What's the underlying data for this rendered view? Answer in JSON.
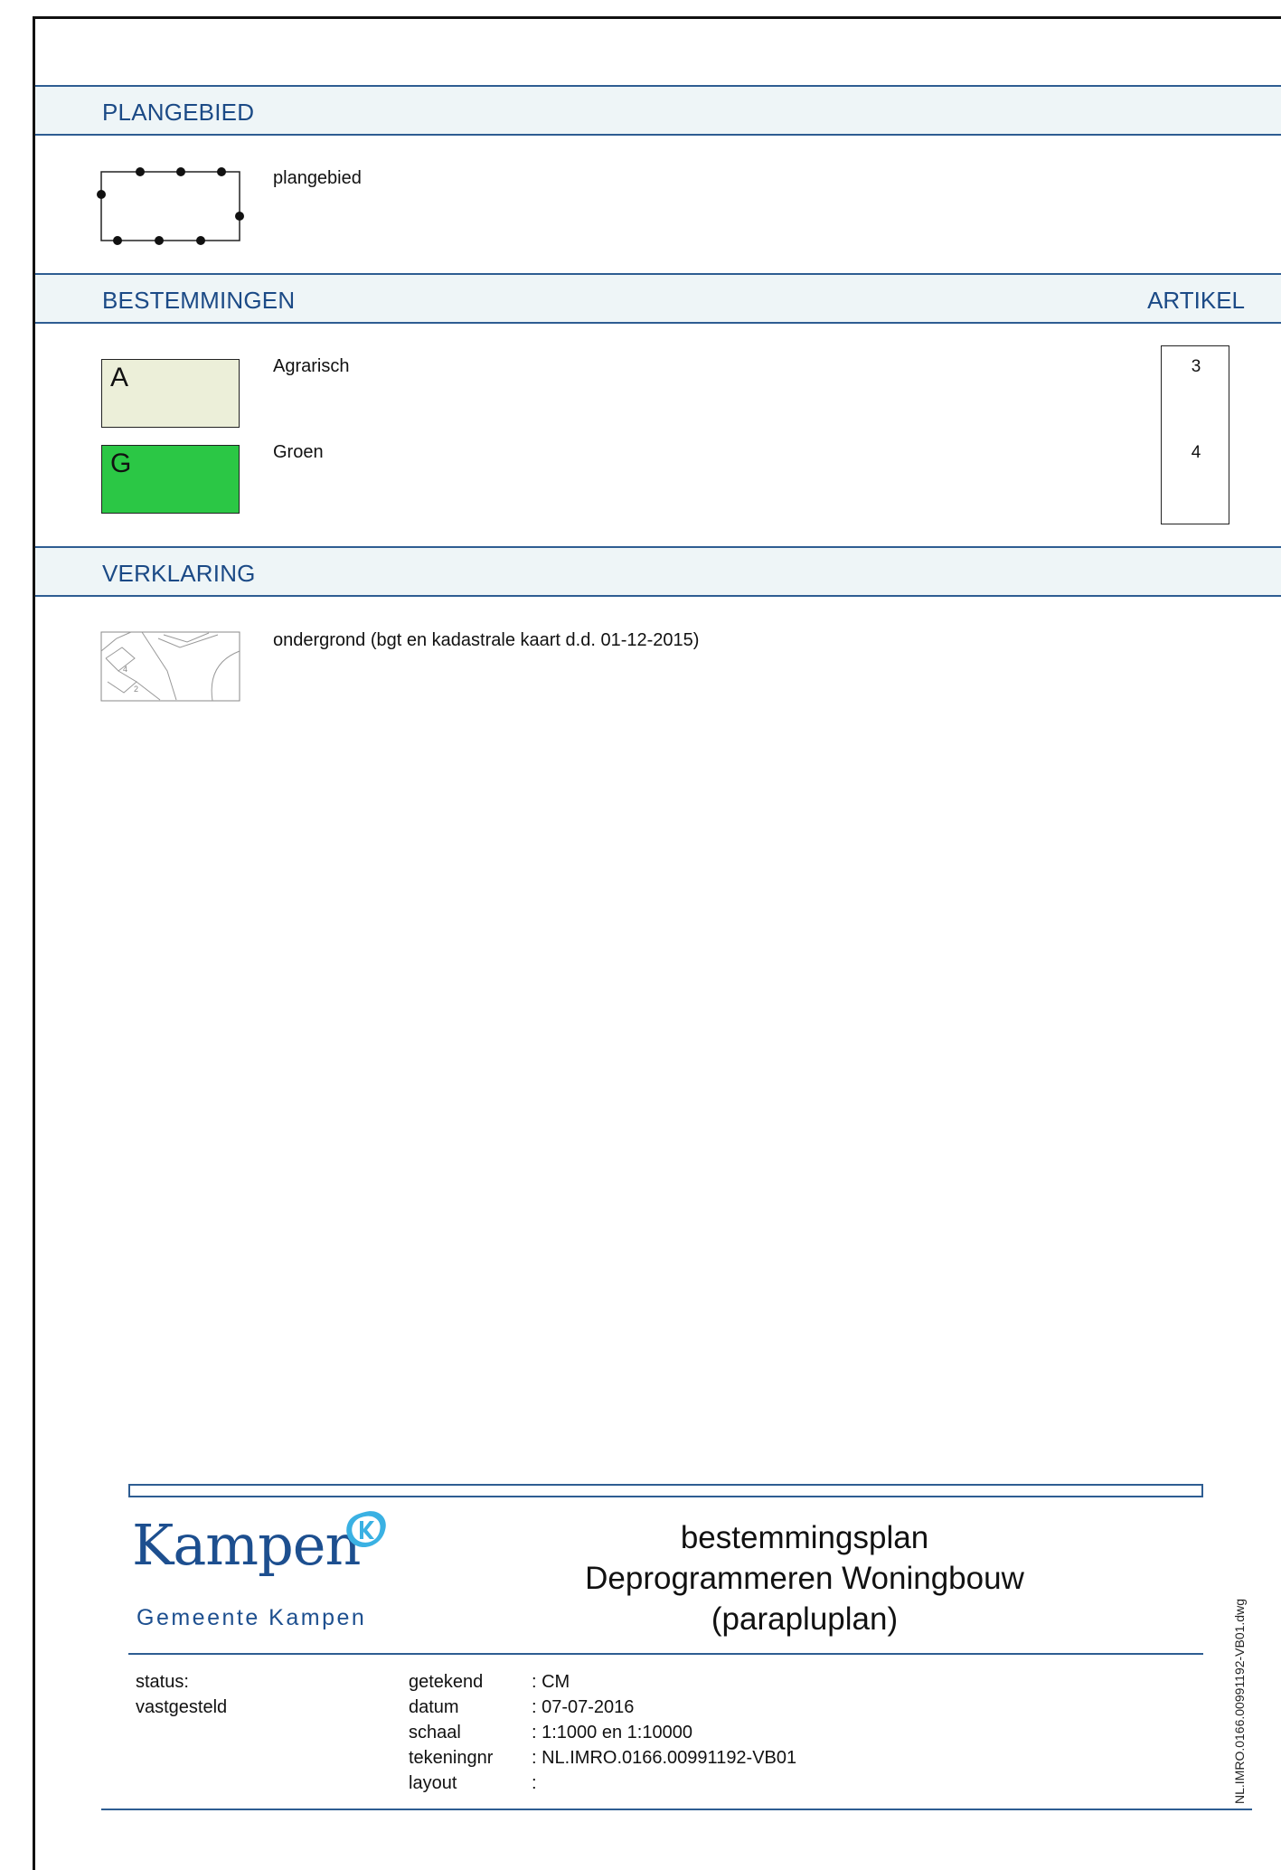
{
  "sections": {
    "plangebied": {
      "title": "PLANGEBIED",
      "item_label": "plangebied"
    },
    "bestemmingen": {
      "title": "BESTEMMINGEN",
      "artikel_header": "ARTIKEL",
      "items": [
        {
          "code": "A",
          "label": "Agrarisch",
          "artikel": "3",
          "color": "#ecefd9"
        },
        {
          "code": "G",
          "label": "Groen",
          "artikel": "4",
          "color": "#2bc745"
        }
      ]
    },
    "verklaring": {
      "title": "VERKLARING",
      "item_label": "ondergrond (bgt en kadastrale kaart d.d. 01-12-2015)",
      "map_numbers": [
        "4",
        "2"
      ]
    }
  },
  "titleblock": {
    "logo_text": "Kampen",
    "logo_subtitle": "Gemeente Kampen",
    "plan_title": [
      "bestemmingsplan",
      "Deprogrammeren Woningbouw",
      "(parapluplan)"
    ],
    "status_label": "status:",
    "status_value": "vastgesteld",
    "fields": [
      {
        "label": "getekend",
        "value": ": CM"
      },
      {
        "label": "datum",
        "value": ": 07-07-2016"
      },
      {
        "label": "schaal",
        "value": ": 1:1000 en 1:10000"
      },
      {
        "label": "tekeningnr",
        "value": ": NL.IMRO.0166.00991192-VB01"
      },
      {
        "label": "layout",
        "value": ":"
      }
    ],
    "filename": "NL.IMRO.0166.00991192-VB01.dwg"
  },
  "colors": {
    "heading_blue": "#1b4a86",
    "band_bg": "#eef5f7",
    "rule_blue": "#2e5d92"
  }
}
